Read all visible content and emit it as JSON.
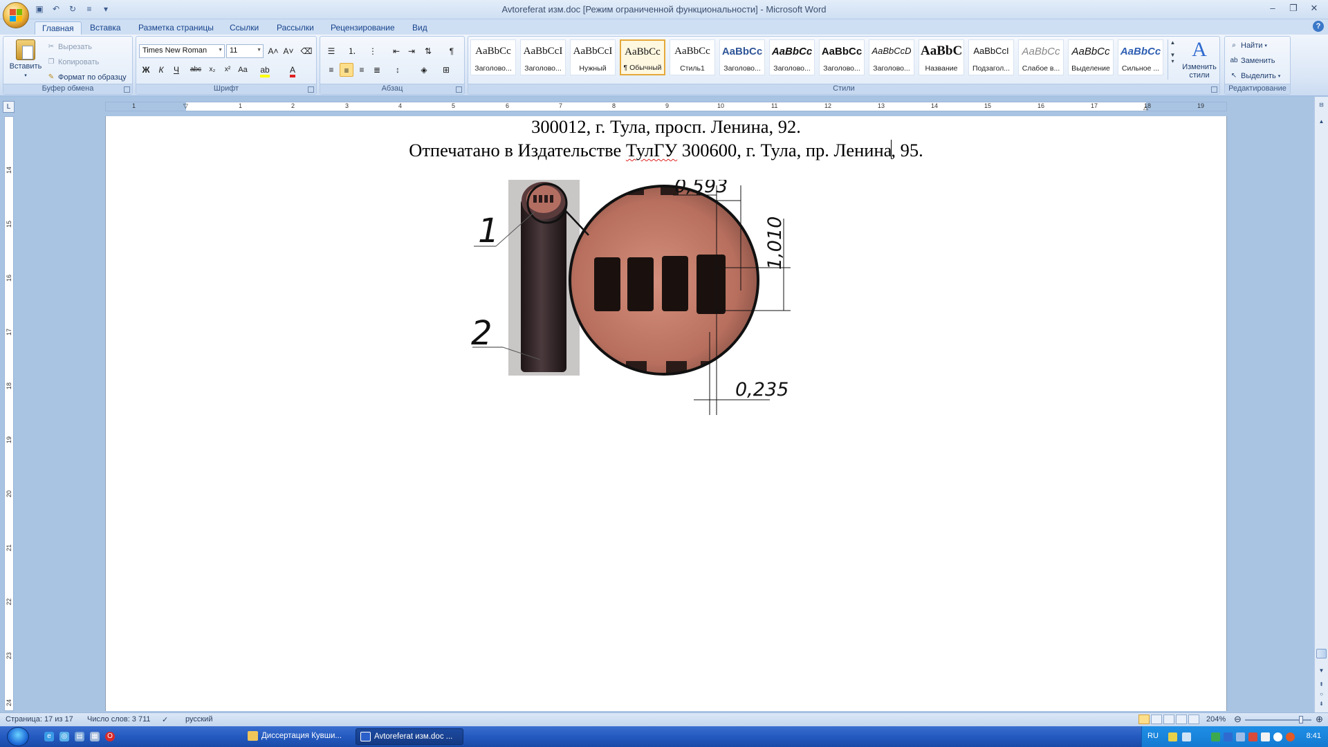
{
  "window": {
    "title": "Avtoreferat изм.doc [Режим ограниченной функциональности] - Microsoft Word"
  },
  "tabs": [
    "Главная",
    "Вставка",
    "Разметка страницы",
    "Ссылки",
    "Рассылки",
    "Рецензирование",
    "Вид"
  ],
  "ribbon": {
    "clipboard": {
      "paste": "Вставить",
      "cut": "Вырезать",
      "copy": "Копировать",
      "format_painter": "Формат по образцу",
      "label": "Буфер обмена"
    },
    "font": {
      "name": "Times New Roman",
      "size": "11",
      "label": "Шрифт"
    },
    "paragraph": {
      "label": "Абзац"
    },
    "styles": {
      "label": "Стили",
      "items": [
        {
          "sample": "AaBbCc",
          "name": "Заголово..."
        },
        {
          "sample": "AaBbCcI",
          "name": "Заголово..."
        },
        {
          "sample": "AaBbCcI",
          "name": "Нужный"
        },
        {
          "sample": "AaBbCc",
          "name": "¶ Обычный"
        },
        {
          "sample": "AaBbCc",
          "name": "Стиль1"
        },
        {
          "sample": "AaBbCc",
          "name": "Заголово..."
        },
        {
          "sample": "AaBbCc",
          "name": "Заголово..."
        },
        {
          "sample": "AaBbCc",
          "name": "Заголово..."
        },
        {
          "sample": "AaBbCcD",
          "name": "Заголово..."
        },
        {
          "sample": "AaBbC",
          "name": "Название"
        },
        {
          "sample": "AaBbCcI",
          "name": "Подзагол..."
        },
        {
          "sample": "AaBbCc",
          "name": "Слабое в..."
        },
        {
          "sample": "AaBbCc",
          "name": "Выделение"
        },
        {
          "sample": "AaBbCc",
          "name": "Сильное ..."
        }
      ],
      "change_styles": "Изменить стили"
    },
    "editing": {
      "find": "Найти",
      "replace": "Заменить",
      "select": "Выделить",
      "label": "Редактирование"
    }
  },
  "ruler": {
    "h_numbers": [
      "1",
      "1",
      "2",
      "3",
      "4",
      "5",
      "6",
      "7",
      "8",
      "9",
      "10",
      "11",
      "12",
      "13",
      "14",
      "15",
      "16",
      "17",
      "18",
      "19"
    ],
    "v_numbers": [
      "14",
      "15",
      "16",
      "17",
      "18",
      "19",
      "20",
      "21",
      "22",
      "23",
      "24"
    ]
  },
  "document": {
    "line1": "300012, г. Тула, просп. Ленина, 92.",
    "line2_a": "Отпечатано в Издательстве ",
    "line2_b": "ТулГУ",
    "line2_c": " 300600, г. Тула, пр. Ленина",
    "line2_d": ", 95.",
    "figure": {
      "label_1": "1",
      "label_2": "2",
      "dim_top": "0,593",
      "dim_right": "1,010",
      "dim_bottom": "0,235"
    }
  },
  "statusbar": {
    "page": "Страница: 17 из 17",
    "words": "Число слов: 3 711",
    "language": "русский",
    "zoom": "204%"
  },
  "taskbar": {
    "items": [
      "Диссертация Кувши...",
      "Avtoreferat изм.doc ..."
    ],
    "lang": "RU",
    "clock": "8:41"
  }
}
